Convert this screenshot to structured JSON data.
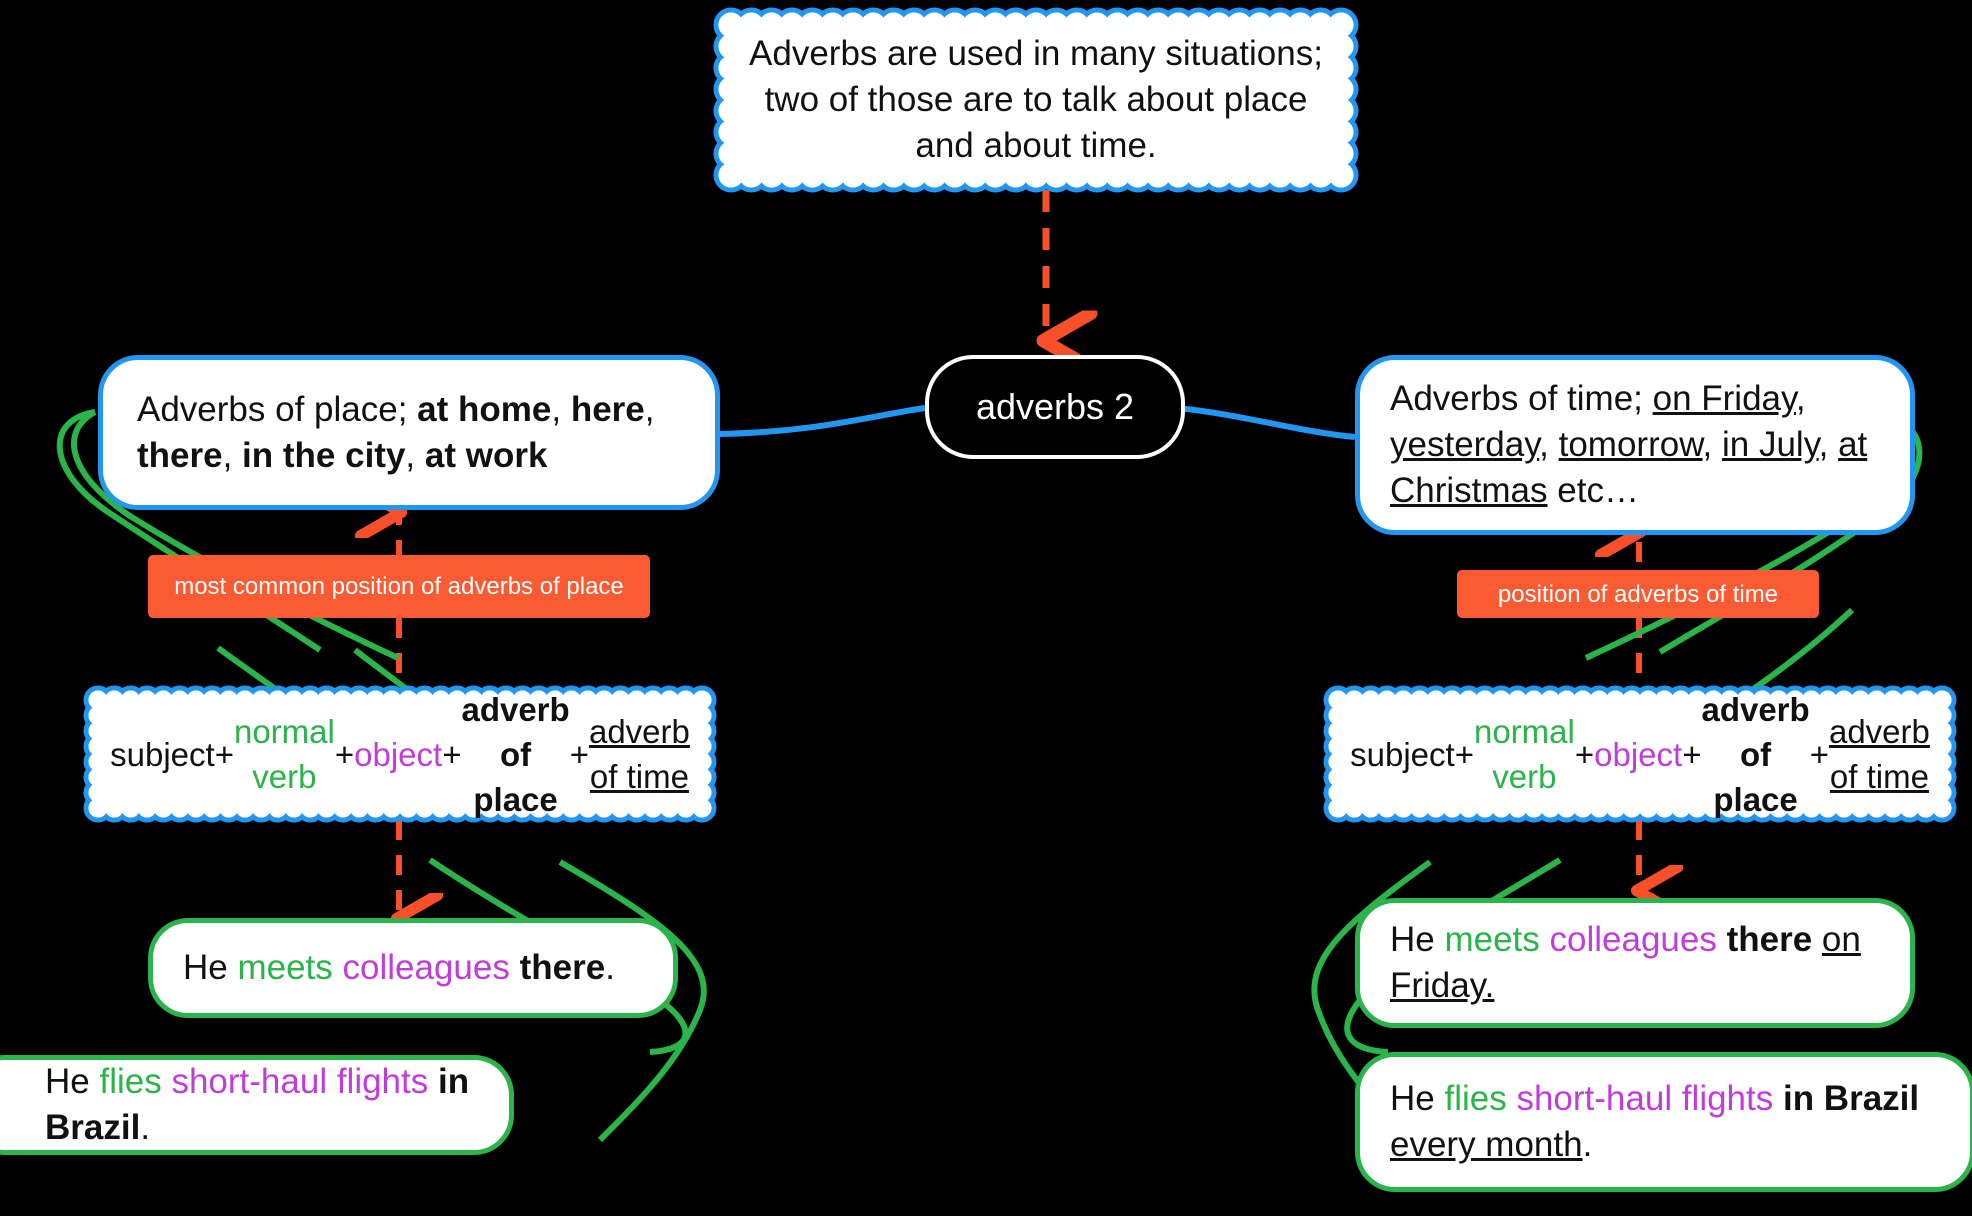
{
  "colors": {
    "background": "#000000",
    "blue_border": "#2196f3",
    "green_border": "#2ab44a",
    "orange_label": "#fb5b33",
    "verb_green": "#2ab44a",
    "object_purple": "#c13ddb",
    "center_text": "#ffffff",
    "body_text": "#111111"
  },
  "root_note": {
    "text": "Adverbs are used in many situations; two of those are to talk about place and about time."
  },
  "center": {
    "label": "adverbs 2"
  },
  "left_branch": {
    "topic": {
      "lead": "Adverbs of place; ",
      "examples": [
        "at home",
        "here",
        "there",
        "in the city",
        "at work"
      ]
    },
    "orange_label": "most common position of adverbs of place",
    "formula": {
      "subject": "subject",
      "plus": " + ",
      "verb": "normal verb",
      "object": "object",
      "adverb_place": "adverb of place",
      "adverb_time": "adverb of time"
    },
    "examples": [
      {
        "subject": "He ",
        "verb": "meets",
        "object": "colleagues",
        "place": "there",
        "time": "",
        "end": "."
      },
      {
        "subject": "He ",
        "verb": "flies",
        "object": "short-haul flights",
        "place": "in Brazil",
        "time": "",
        "end": "."
      }
    ]
  },
  "right_branch": {
    "topic": {
      "lead": "Adverbs of time; ",
      "examples": [
        "on Friday",
        "yesterday",
        "tomorrow",
        "in July",
        "at Christmas"
      ],
      "tail": " etc…"
    },
    "orange_label": "position of adverbs of time",
    "formula": {
      "subject": "subject",
      "plus": " + ",
      "verb": "normal verb",
      "object": "object",
      "adverb_place": "adverb of place",
      "adverb_time": "adverb of time"
    },
    "examples": [
      {
        "subject": "He ",
        "verb": "meets",
        "object": "colleagues",
        "place": "there",
        "time": "on Friday",
        "end": "."
      },
      {
        "subject": "He ",
        "verb": "flies",
        "object": "short-haul flights",
        "place": "in Brazil",
        "time": "every month",
        "end": "."
      }
    ]
  }
}
